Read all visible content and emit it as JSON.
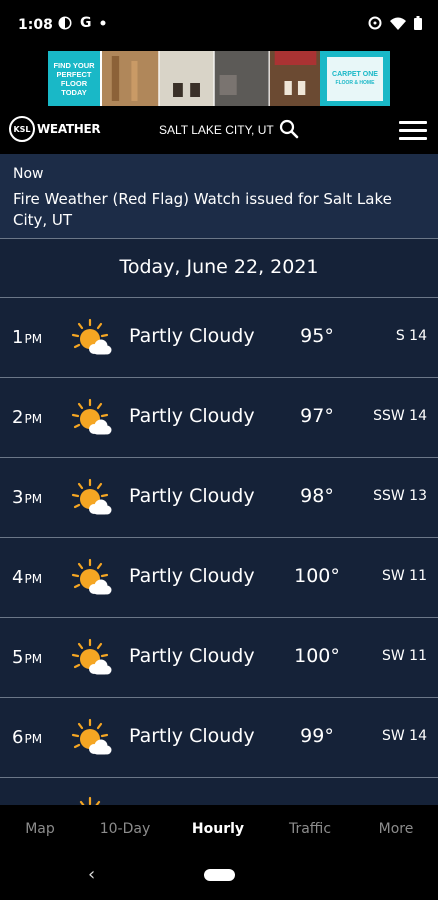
{
  "status_bar": {
    "time": "1:08",
    "g_letter": "G"
  },
  "ad": {
    "left_text": "FIND YOUR PERFECT FLOOR TODAY",
    "right_text": "CARPET ONE",
    "right_sub": "FLOOR & HOME"
  },
  "header": {
    "logo_mark": "KSL",
    "logo_text": "WEATHER",
    "city": "SALT LAKE CITY, UT"
  },
  "alert": {
    "label": "Now",
    "text": "Fire Weather (Red Flag) Watch issued for Salt Lake City, UT"
  },
  "date_heading": "Today, June 22, 2021",
  "hours": [
    {
      "hour": "1",
      "ampm": "PM",
      "condition": "Partly Cloudy",
      "temp": "95°",
      "wind": "S 14"
    },
    {
      "hour": "2",
      "ampm": "PM",
      "condition": "Partly Cloudy",
      "temp": "97°",
      "wind": "SSW 14"
    },
    {
      "hour": "3",
      "ampm": "PM",
      "condition": "Partly Cloudy",
      "temp": "98°",
      "wind": "SSW 13"
    },
    {
      "hour": "4",
      "ampm": "PM",
      "condition": "Partly Cloudy",
      "temp": "100°",
      "wind": "SW 11"
    },
    {
      "hour": "5",
      "ampm": "PM",
      "condition": "Partly Cloudy",
      "temp": "100°",
      "wind": "SW 11"
    },
    {
      "hour": "6",
      "ampm": "PM",
      "condition": "Partly Cloudy",
      "temp": "99°",
      "wind": "SW 14"
    }
  ],
  "nav": [
    {
      "label": "Map",
      "active": false
    },
    {
      "label": "10-Day",
      "active": false
    },
    {
      "label": "Hourly",
      "active": true
    },
    {
      "label": "Traffic",
      "active": false
    },
    {
      "label": "More",
      "active": false
    }
  ],
  "colors": {
    "background": "#152238",
    "alert_background": "#1c2c47",
    "divider": "#6b7788",
    "sun": "#f5a623",
    "ad_teal": "#19b8c7"
  },
  "icons": {
    "search": "search-icon",
    "menu": "hamburger-menu-icon",
    "weather": "partly-cloudy-icon"
  }
}
